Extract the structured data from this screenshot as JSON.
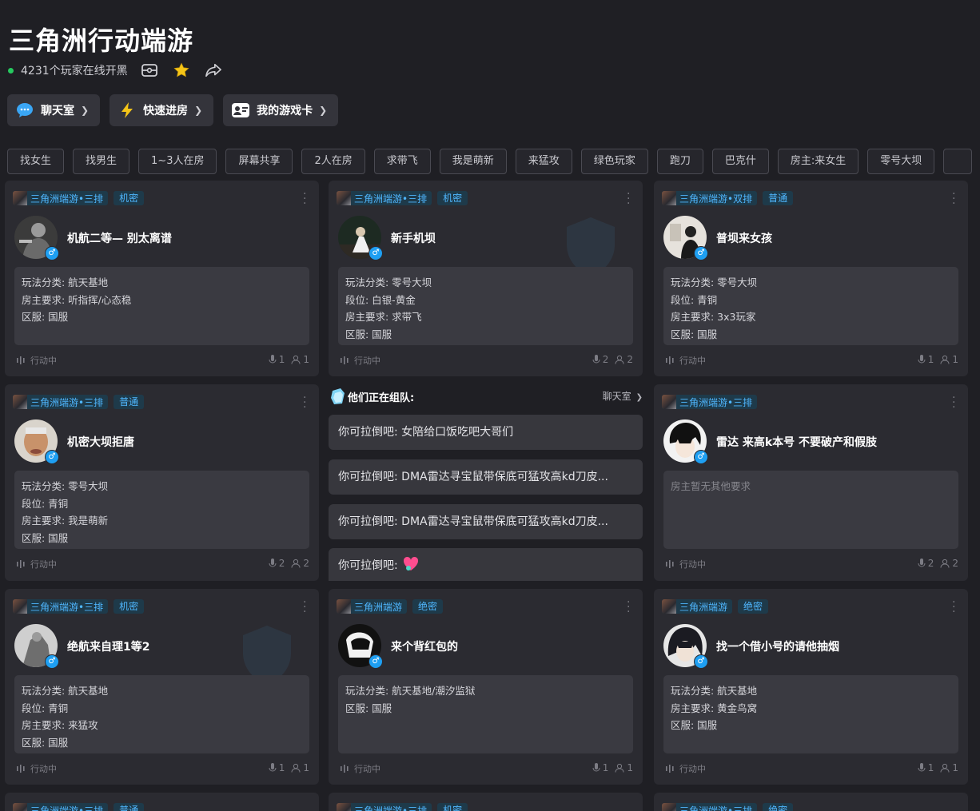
{
  "header": {
    "title": "三角洲行动端游",
    "online_text": "4231个玩家在线开黑"
  },
  "quick_nav": [
    {
      "label": "聊天室",
      "icon": "chat-bubble-icon"
    },
    {
      "label": "快速进房",
      "icon": "lightning-icon"
    },
    {
      "label": "我的游戏卡",
      "icon": "game-card-icon"
    }
  ],
  "filter_tags": [
    "找女生",
    "找男生",
    "1~3人在房",
    "屏幕共享",
    "2人在房",
    "求带飞",
    "我是萌新",
    "来猛攻",
    "绿色玩家",
    "跑刀",
    "巴克什",
    "房主:来女生",
    "零号大坝"
  ],
  "status_text": "行动中",
  "cards": [
    {
      "game": "三角洲端游•三排",
      "mode": "机密",
      "title": "机航二等— 别太离谱",
      "lines": [
        "玩法分类: 航天基地",
        "房主要求: 听指挥/心态稳",
        "区服: 国服"
      ],
      "mic": "1",
      "members": "1"
    },
    {
      "game": "三角洲端游•三排",
      "mode": "机密",
      "title": "新手机坝",
      "lines": [
        "玩法分类: 零号大坝",
        "段位: 白银-黄金",
        "房主要求: 求带飞",
        "区服: 国服"
      ],
      "mic": "2",
      "members": "2"
    },
    {
      "game": "三角洲端游•双排",
      "mode": "普通",
      "title": "普坝来女孩",
      "lines": [
        "玩法分类: 零号大坝",
        "段位: 青铜",
        "房主要求: 3x3玩家",
        "区服: 国服"
      ],
      "mic": "1",
      "members": "1"
    },
    {
      "game": "三角洲端游•三排",
      "mode": "普通",
      "title": "机密大坝拒唐",
      "lines": [
        "玩法分类: 零号大坝",
        "段位: 青铜",
        "房主要求: 我是萌新",
        "区服: 国服"
      ],
      "mic": "2",
      "members": "2"
    },
    {
      "game": "三角洲端游•三排",
      "mode": "",
      "title": "雷达 来高k本号 不要破产和假肢",
      "lines": [],
      "empty_text": "房主暂无其他要求",
      "mic": "2",
      "members": "2"
    },
    {
      "game": "三角洲端游•三排",
      "mode": "机密",
      "title": "绝航来自理1等2",
      "lines": [
        "玩法分类: 航天基地",
        "段位: 青铜",
        "房主要求: 来猛攻",
        "区服: 国服"
      ],
      "mic": "1",
      "members": "1"
    },
    {
      "game": "三角洲端游",
      "mode": "绝密",
      "title": "来个背红包的",
      "lines": [
        "玩法分类: 航天基地/潮汐监狱",
        "区服: 国服"
      ],
      "mic": "1",
      "members": "1"
    },
    {
      "game": "三角洲端游",
      "mode": "绝密",
      "title": "找一个借小号的请他抽烟",
      "lines": [
        "玩法分类: 航天基地",
        "房主要求: 黄金鸟窝",
        "区服: 国服"
      ],
      "mic": "1",
      "members": "1"
    },
    {
      "game": "三角洲端游•三排",
      "mode": "普通"
    },
    {
      "game": "三角洲端游•三排",
      "mode": "机密"
    },
    {
      "game": "三角洲端游•三排",
      "mode": "绝密"
    }
  ],
  "chat_panel": {
    "title": "他们正在组队:",
    "link": "聊天室",
    "messages": [
      "你可拉倒吧: 女陪给口饭吃吧大哥们",
      "你可拉倒吧: DMA雷达寻宝鼠带保底可猛攻高kd刀皮...",
      "你可拉倒吧: DMA雷达寻宝鼠带保底可猛攻高kd刀皮...",
      "你可拉倒吧: "
    ]
  },
  "colors": {
    "accent_blue": "#4fb7ff",
    "online_green": "#26c95f",
    "star_yellow": "#f5c518",
    "male_blue": "#1e9ff2"
  }
}
